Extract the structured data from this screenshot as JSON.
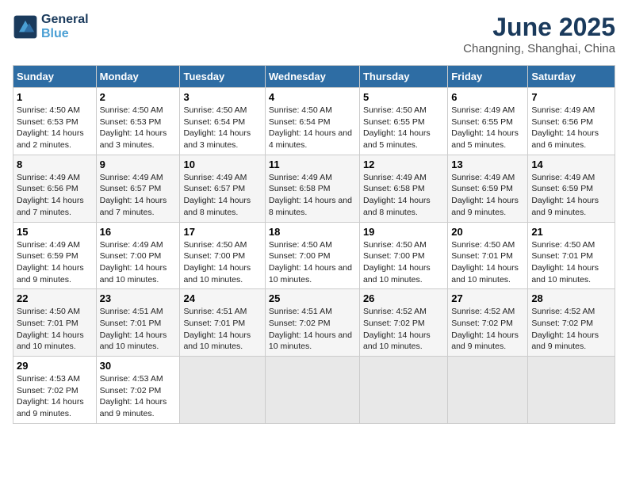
{
  "logo": {
    "line1": "General",
    "line2": "Blue"
  },
  "title": "June 2025",
  "subtitle": "Changning, Shanghai, China",
  "headers": [
    "Sunday",
    "Monday",
    "Tuesday",
    "Wednesday",
    "Thursday",
    "Friday",
    "Saturday"
  ],
  "weeks": [
    [
      {
        "day": "1",
        "sunrise": "4:50 AM",
        "sunset": "6:53 PM",
        "daylight": "14 hours and 2 minutes."
      },
      {
        "day": "2",
        "sunrise": "4:50 AM",
        "sunset": "6:53 PM",
        "daylight": "14 hours and 3 minutes."
      },
      {
        "day": "3",
        "sunrise": "4:50 AM",
        "sunset": "6:54 PM",
        "daylight": "14 hours and 3 minutes."
      },
      {
        "day": "4",
        "sunrise": "4:50 AM",
        "sunset": "6:54 PM",
        "daylight": "14 hours and 4 minutes."
      },
      {
        "day": "5",
        "sunrise": "4:50 AM",
        "sunset": "6:55 PM",
        "daylight": "14 hours and 5 minutes."
      },
      {
        "day": "6",
        "sunrise": "4:49 AM",
        "sunset": "6:55 PM",
        "daylight": "14 hours and 5 minutes."
      },
      {
        "day": "7",
        "sunrise": "4:49 AM",
        "sunset": "6:56 PM",
        "daylight": "14 hours and 6 minutes."
      }
    ],
    [
      {
        "day": "8",
        "sunrise": "4:49 AM",
        "sunset": "6:56 PM",
        "daylight": "14 hours and 7 minutes."
      },
      {
        "day": "9",
        "sunrise": "4:49 AM",
        "sunset": "6:57 PM",
        "daylight": "14 hours and 7 minutes."
      },
      {
        "day": "10",
        "sunrise": "4:49 AM",
        "sunset": "6:57 PM",
        "daylight": "14 hours and 8 minutes."
      },
      {
        "day": "11",
        "sunrise": "4:49 AM",
        "sunset": "6:58 PM",
        "daylight": "14 hours and 8 minutes."
      },
      {
        "day": "12",
        "sunrise": "4:49 AM",
        "sunset": "6:58 PM",
        "daylight": "14 hours and 8 minutes."
      },
      {
        "day": "13",
        "sunrise": "4:49 AM",
        "sunset": "6:59 PM",
        "daylight": "14 hours and 9 minutes."
      },
      {
        "day": "14",
        "sunrise": "4:49 AM",
        "sunset": "6:59 PM",
        "daylight": "14 hours and 9 minutes."
      }
    ],
    [
      {
        "day": "15",
        "sunrise": "4:49 AM",
        "sunset": "6:59 PM",
        "daylight": "14 hours and 9 minutes."
      },
      {
        "day": "16",
        "sunrise": "4:49 AM",
        "sunset": "7:00 PM",
        "daylight": "14 hours and 10 minutes."
      },
      {
        "day": "17",
        "sunrise": "4:50 AM",
        "sunset": "7:00 PM",
        "daylight": "14 hours and 10 minutes."
      },
      {
        "day": "18",
        "sunrise": "4:50 AM",
        "sunset": "7:00 PM",
        "daylight": "14 hours and 10 minutes."
      },
      {
        "day": "19",
        "sunrise": "4:50 AM",
        "sunset": "7:00 PM",
        "daylight": "14 hours and 10 minutes."
      },
      {
        "day": "20",
        "sunrise": "4:50 AM",
        "sunset": "7:01 PM",
        "daylight": "14 hours and 10 minutes."
      },
      {
        "day": "21",
        "sunrise": "4:50 AM",
        "sunset": "7:01 PM",
        "daylight": "14 hours and 10 minutes."
      }
    ],
    [
      {
        "day": "22",
        "sunrise": "4:50 AM",
        "sunset": "7:01 PM",
        "daylight": "14 hours and 10 minutes."
      },
      {
        "day": "23",
        "sunrise": "4:51 AM",
        "sunset": "7:01 PM",
        "daylight": "14 hours and 10 minutes."
      },
      {
        "day": "24",
        "sunrise": "4:51 AM",
        "sunset": "7:01 PM",
        "daylight": "14 hours and 10 minutes."
      },
      {
        "day": "25",
        "sunrise": "4:51 AM",
        "sunset": "7:02 PM",
        "daylight": "14 hours and 10 minutes."
      },
      {
        "day": "26",
        "sunrise": "4:52 AM",
        "sunset": "7:02 PM",
        "daylight": "14 hours and 10 minutes."
      },
      {
        "day": "27",
        "sunrise": "4:52 AM",
        "sunset": "7:02 PM",
        "daylight": "14 hours and 9 minutes."
      },
      {
        "day": "28",
        "sunrise": "4:52 AM",
        "sunset": "7:02 PM",
        "daylight": "14 hours and 9 minutes."
      }
    ],
    [
      {
        "day": "29",
        "sunrise": "4:53 AM",
        "sunset": "7:02 PM",
        "daylight": "14 hours and 9 minutes."
      },
      {
        "day": "30",
        "sunrise": "4:53 AM",
        "sunset": "7:02 PM",
        "daylight": "14 hours and 9 minutes."
      },
      null,
      null,
      null,
      null,
      null
    ]
  ]
}
